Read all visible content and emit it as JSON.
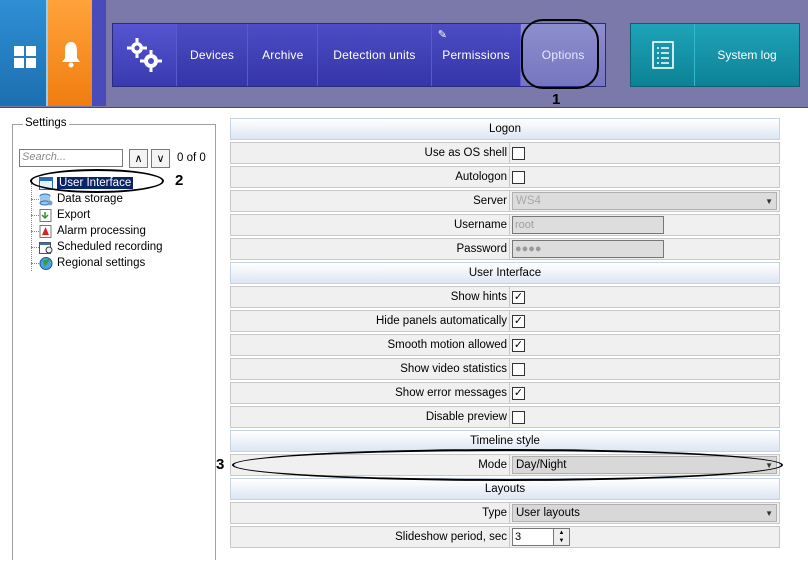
{
  "nav": {
    "items": [
      {
        "label": "Devices"
      },
      {
        "label": "Archive"
      },
      {
        "label": "Detection units"
      },
      {
        "label": "Permissions"
      },
      {
        "label": "Options"
      }
    ],
    "system_log": "System log"
  },
  "callouts": [
    "1",
    "2",
    "3"
  ],
  "settings": {
    "title": "Settings",
    "search_placeholder": "Search...",
    "count": "0 of 0",
    "tree": [
      {
        "label": "User Interface",
        "icon": "window-icon",
        "selected": true
      },
      {
        "label": "Data storage",
        "icon": "database-icon"
      },
      {
        "label": "Export",
        "icon": "export-icon"
      },
      {
        "label": "Alarm processing",
        "icon": "alarm-icon"
      },
      {
        "label": "Scheduled recording",
        "icon": "schedule-icon"
      },
      {
        "label": "Regional settings",
        "icon": "globe-icon"
      }
    ]
  },
  "grid": {
    "logon": {
      "title": "Logon",
      "use_os_shell": "Use as OS shell",
      "autologon": "Autologon",
      "server": "Server",
      "server_value": "WS4",
      "username": "Username",
      "username_value": "root",
      "password": "Password",
      "password_value": "●●●●"
    },
    "ui": {
      "title": "User Interface",
      "rows": [
        {
          "label": "Show hints",
          "checked": true
        },
        {
          "label": "Hide panels automatically",
          "checked": true
        },
        {
          "label": "Smooth motion allowed",
          "checked": true
        },
        {
          "label": "Show video statistics",
          "checked": false
        },
        {
          "label": "Show error messages",
          "checked": true
        },
        {
          "label": "Disable preview",
          "checked": false
        }
      ]
    },
    "timeline": {
      "title": "Timeline style",
      "mode": "Mode",
      "mode_value": "Day/Night"
    },
    "layouts": {
      "title": "Layouts",
      "type": "Type",
      "type_value": "User layouts",
      "slideshow": "Slideshow period, sec",
      "slideshow_value": "3"
    }
  },
  "colors": {
    "accent_windows": "#1c6fb0",
    "accent_alarm": "#f07d10",
    "nav_bg": "#3c3cb0",
    "syslog_bg": "#0c8296",
    "selection": "#0a246a"
  }
}
